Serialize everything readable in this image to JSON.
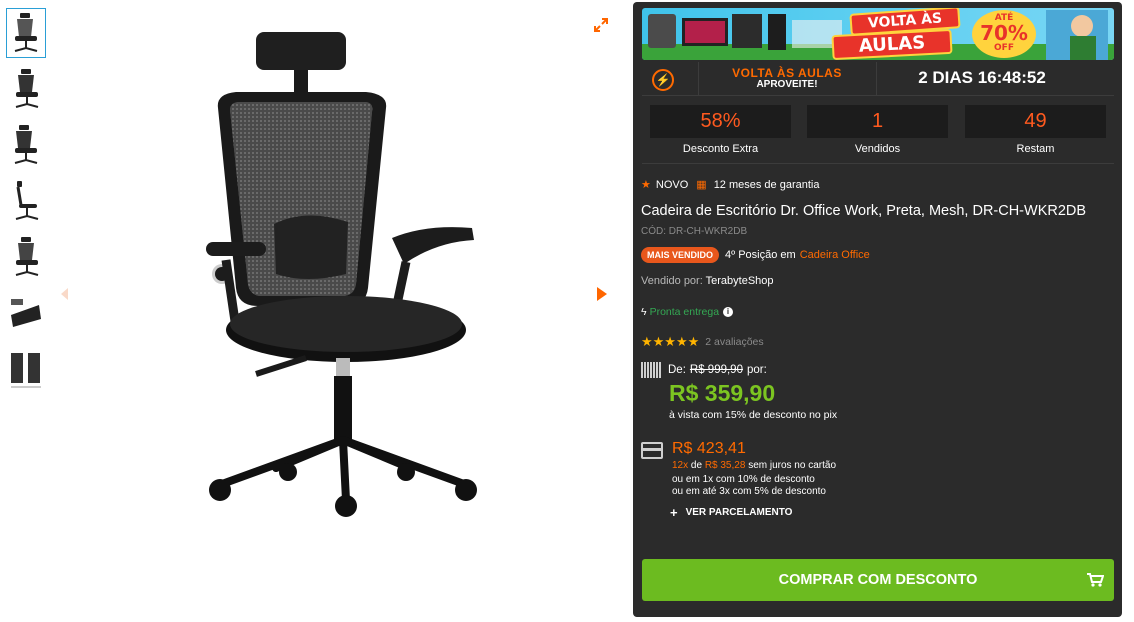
{
  "gallery": {
    "thumbnail_count": 7,
    "active_index": 0
  },
  "banner": {
    "line1": "VOLTA ÀS",
    "line2": "AULAS",
    "discount_prefix": "ATÉ",
    "discount_value": "70%",
    "discount_suffix": "OFF"
  },
  "countdown": {
    "icon": "clock-icon",
    "title": "VOLTA ÀS AULAS",
    "subtitle": "APROVEITE!",
    "time": "2 DIAS 16:48:52"
  },
  "stats": [
    {
      "value": "58%",
      "label": "Desconto Extra"
    },
    {
      "value": "1",
      "label": "Vendidos"
    },
    {
      "value": "49",
      "label": "Restam"
    }
  ],
  "tags": {
    "condition": "NOVO",
    "warranty": "12 meses de garantia"
  },
  "product": {
    "title": "Cadeira de Escritório Dr. Office Work, Preta, Mesh, DR-CH-WKR2DB",
    "code": "CÓD: DR-CH-WKR2DB",
    "badge": "MAIS VENDIDO",
    "position": "4º Posição em",
    "category": "Cadeira Office",
    "seller_label": "Vendido por:",
    "seller": "TerabyteShop",
    "delivery": "Pronta entrega",
    "stars": "★★★★★",
    "reviews": "2 avaliações"
  },
  "pricing": {
    "from_label": "De:",
    "old_price": "R$ 999,90",
    "por_label": "por:",
    "price": "R$ 359,90",
    "pix_note": "à vista com 15% de desconto no pix",
    "card_price": "R$ 423,41",
    "inst_count": "12x",
    "inst_de": "de",
    "inst_value": "R$ 35,28",
    "inst_suffix": "sem juros no cartão",
    "option1": "ou em 1x com 10% de desconto",
    "option2": "ou em até 3x com 5% de desconto",
    "ver_parcelamento": "VER PARCELAMENTO"
  },
  "buy_button": "COMPRAR COM DESCONTO",
  "colors": {
    "panel_bg": "#2b2b2b",
    "accent_orange": "#ff6a00",
    "price_green": "#7cc521",
    "button_green": "#6cbb20"
  }
}
